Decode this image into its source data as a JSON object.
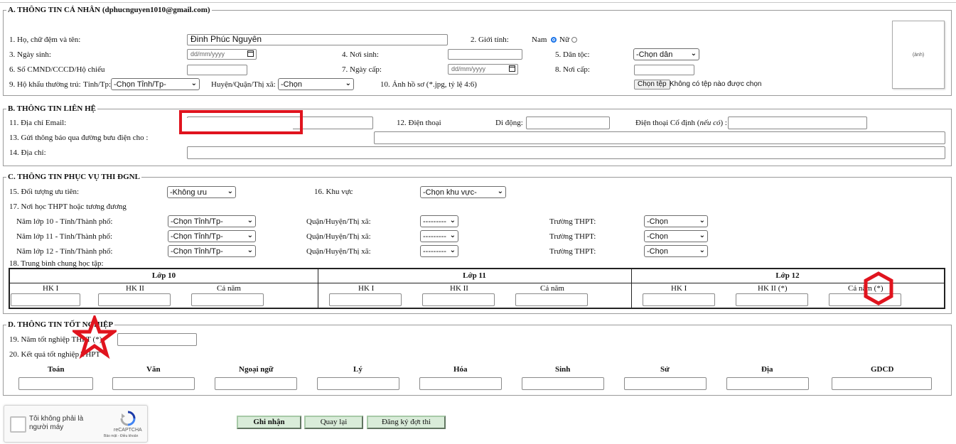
{
  "sectionA": {
    "legend": "A. THÔNG TIN CÁ NHÂN (dphucnguyen1010@gmail.com)",
    "q1_label": "1. Họ, chữ đệm và tên:",
    "q1_value": "Đinh Phúc Nguyên",
    "q2_label": "2. Giới tính:",
    "gender_male": "Nam",
    "gender_female": "Nữ",
    "q3_label": "3. Ngày sinh:",
    "date_placeholder": "dd/mm/yyyy",
    "q4_label": "4. Nơi sinh:",
    "q5_label": "5. Dân tộc:",
    "q5_select": "-Chọn dân tộc-",
    "q6_label": "6. Số CMND/CCCD/Hộ chiếu",
    "q7_label": "7. Ngày cấp:",
    "q8_label": "8. Nơi cấp:",
    "q9_label": "9. Hộ khẩu thường trú:",
    "q9_tinh_label": "Tỉnh/Tp:",
    "q9_tinh_select": "-Chọn Tỉnh/Tp-",
    "q9_huyen_label": "Huyện/Quận/Thị xã:",
    "q9_huyen_select": "-Chọn Quận/Huyện-",
    "q10_label": "10. Ảnh hồ sơ (*.jpg, tỷ lệ 4:6)",
    "file_button": "Chọn tệp",
    "file_status": "Không có tệp nào được chọn",
    "photo_placeholder": "(ảnh)"
  },
  "sectionB": {
    "legend": "B. THÔNG TIN LIÊN HỆ",
    "q11_label": "11. Địa chỉ Email:",
    "q12_label": "12. Điện thoại",
    "mobile_label": "Di động:",
    "landline_label": "Điện thoại Cố định (",
    "landline_optional": "nếu có",
    "landline_suffix": ") :",
    "q13_label": "13. Gửi thông báo qua đường bưu điện cho :",
    "q14_label": "14. Địa chỉ:"
  },
  "sectionC": {
    "legend": "C. THÔNG TIN PHỤC VỤ THI ĐGNL",
    "q15_label": "15. Đối tượng ưu tiên:",
    "q15_select": "-Không ưu tiên-",
    "q16_label": "16. Khu vực",
    "q16_select": "-Chọn khu vực-",
    "q17_label": "17. Nơi học THPT hoặc tương đương",
    "school_rows": [
      {
        "year_label": "Năm lớp 10 - Tỉnh/Thành phố:",
        "province": "-Chọn Tỉnh/Tp-",
        "district_label": "Quận/Huyện/Thị xã:",
        "district": "----------",
        "school_label": "Trường THPT:",
        "school": "-Chọn trường-"
      },
      {
        "year_label": "Năm lớp 11 - Tỉnh/Thành phố:",
        "province": "-Chọn Tỉnh/Tp-",
        "district_label": "Quận/Huyện/Thị xã:",
        "district": "----------",
        "school_label": "Trường THPT:",
        "school": "-Chọn trường-"
      },
      {
        "year_label": "Năm lớp 12 - Tỉnh/Thành phố:",
        "province": "-Chọn Tỉnh/Tp-",
        "district_label": "Quận/Huyện/Thị xã:",
        "district": "----------",
        "school_label": "Trường THPT:",
        "school": "-Chọn trường-"
      }
    ],
    "q18_label": "18. Trung bình chung học tập:",
    "grades": [
      {
        "header": "Lớp 10",
        "cols": [
          "HK I",
          "HK II",
          "Cả năm"
        ]
      },
      {
        "header": "Lớp 11",
        "cols": [
          "HK I",
          "HK II",
          "Cả năm"
        ]
      },
      {
        "header": "Lớp 12",
        "cols": [
          "HK I",
          "HK II (*)",
          "Cả năm (*)"
        ]
      }
    ]
  },
  "sectionD": {
    "legend": "D. THÔNG TIN TỐT NGHIỆP",
    "q19_label": "19. Năm tốt nghiệp THPT (*)",
    "q20_label": "20. Kết quả tốt nghiệp THPT",
    "subjects": [
      "Toán",
      "Văn",
      "Ngoại ngữ",
      "Lý",
      "Hóa",
      "Sinh",
      "Sử",
      "Địa",
      "GDCD"
    ]
  },
  "captcha": {
    "label": "Tôi không phải là người máy",
    "brand": "reCAPTCHA",
    "links": "Bảo mật - Điều khoản"
  },
  "actions": {
    "submit": "Ghi nhận",
    "back": "Quay lại",
    "register": "Đăng ký đợt thi"
  },
  "annotation_color": "#e0141e"
}
